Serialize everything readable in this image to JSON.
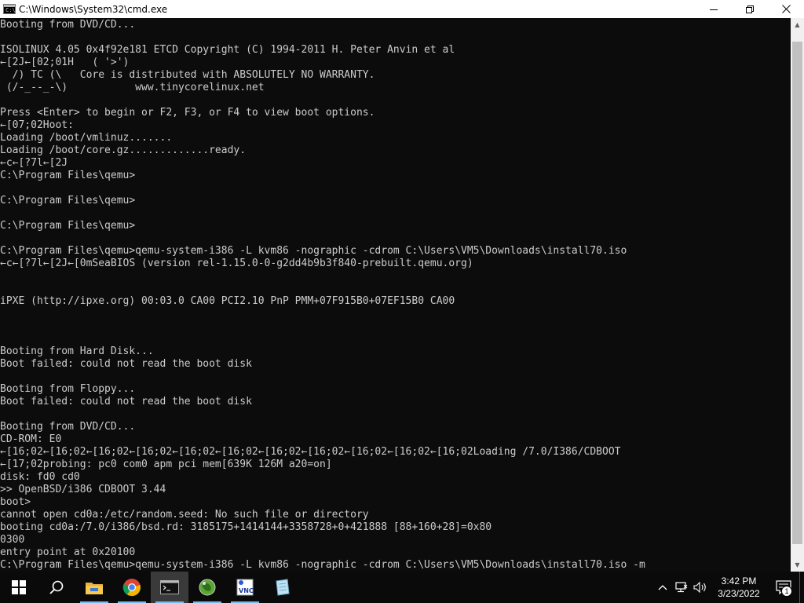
{
  "window": {
    "title": "C:\\Windows\\System32\\cmd.exe",
    "app_icon_text": "C:\\"
  },
  "console": {
    "lines": [
      "Booting from DVD/CD...",
      "",
      "ISOLINUX 4.05 0x4f92e181 ETCD Copyright (C) 1994-2011 H. Peter Anvin et al",
      "←[2J←[02;01H   ( '>')",
      "  /) TC (\\   Core is distributed with ABSOLUTELY NO WARRANTY.",
      " (/-_--_-\\)           www.tinycorelinux.net",
      "",
      "Press <Enter> to begin or F2, F3, or F4 to view boot options.",
      "←[07;02Hoot:",
      "Loading /boot/vmlinuz.......",
      "Loading /boot/core.gz.............ready.",
      "←c←[?7l←[2J",
      "C:\\Program Files\\qemu>",
      "",
      "C:\\Program Files\\qemu>",
      "",
      "C:\\Program Files\\qemu>",
      "",
      "C:\\Program Files\\qemu>qemu-system-i386 -L kvm86 -nographic -cdrom C:\\Users\\VM5\\Downloads\\install70.iso",
      "←c←[?7l←[2J←[0mSeaBIOS (version rel-1.15.0-0-g2dd4b9b3f840-prebuilt.qemu.org)",
      "",
      "",
      "iPXE (http://ipxe.org) 00:03.0 CA00 PCI2.10 PnP PMM+07F915B0+07EF15B0 CA00",
      "",
      "",
      "",
      "Booting from Hard Disk...",
      "Boot failed: could not read the boot disk",
      "",
      "Booting from Floppy...",
      "Boot failed: could not read the boot disk",
      "",
      "Booting from DVD/CD...",
      "CD-ROM: E0",
      "←[16;02←[16;02←[16;02←[16;02←[16;02←[16;02←[16;02←[16;02←[16;02←[16;02←[16;02Loading /7.0/I386/CDBOOT",
      "←[17;02probing: pc0 com0 apm pci mem[639K 126M a20=on]",
      "disk: fd0 cd0",
      ">> OpenBSD/i386 CDBOOT 3.44",
      "boot>",
      "cannot open cd0a:/etc/random.seed: No such file or directory",
      "booting cd0a:/7.0/i386/bsd.rd: 3185175+1414144+3358728+0+421888 [88+160+28]=0x80",
      "0300",
      "entry point at 0x20100",
      "C:\\Program Files\\qemu>qemu-system-i386 -L kvm86 -nographic -cdrom C:\\Users\\VM5\\Downloads\\install70.iso -m"
    ]
  },
  "taskbar": {
    "apps": [
      {
        "name": "start-button",
        "icon": "windows-logo-icon"
      },
      {
        "name": "search-button",
        "icon": "search-icon"
      },
      {
        "name": "file-explorer",
        "icon": "folder-icon"
      },
      {
        "name": "chrome",
        "icon": "chrome-icon"
      },
      {
        "name": "cmd",
        "icon": "terminal-icon"
      },
      {
        "name": "globe-app",
        "icon": "globe-icon"
      },
      {
        "name": "vnc-viewer",
        "icon": "vnc-icon"
      },
      {
        "name": "notepad-app",
        "icon": "notepad-icon"
      }
    ],
    "clock": {
      "time": "3:42 PM",
      "date": "3/23/2022"
    },
    "notification_count": "1"
  }
}
